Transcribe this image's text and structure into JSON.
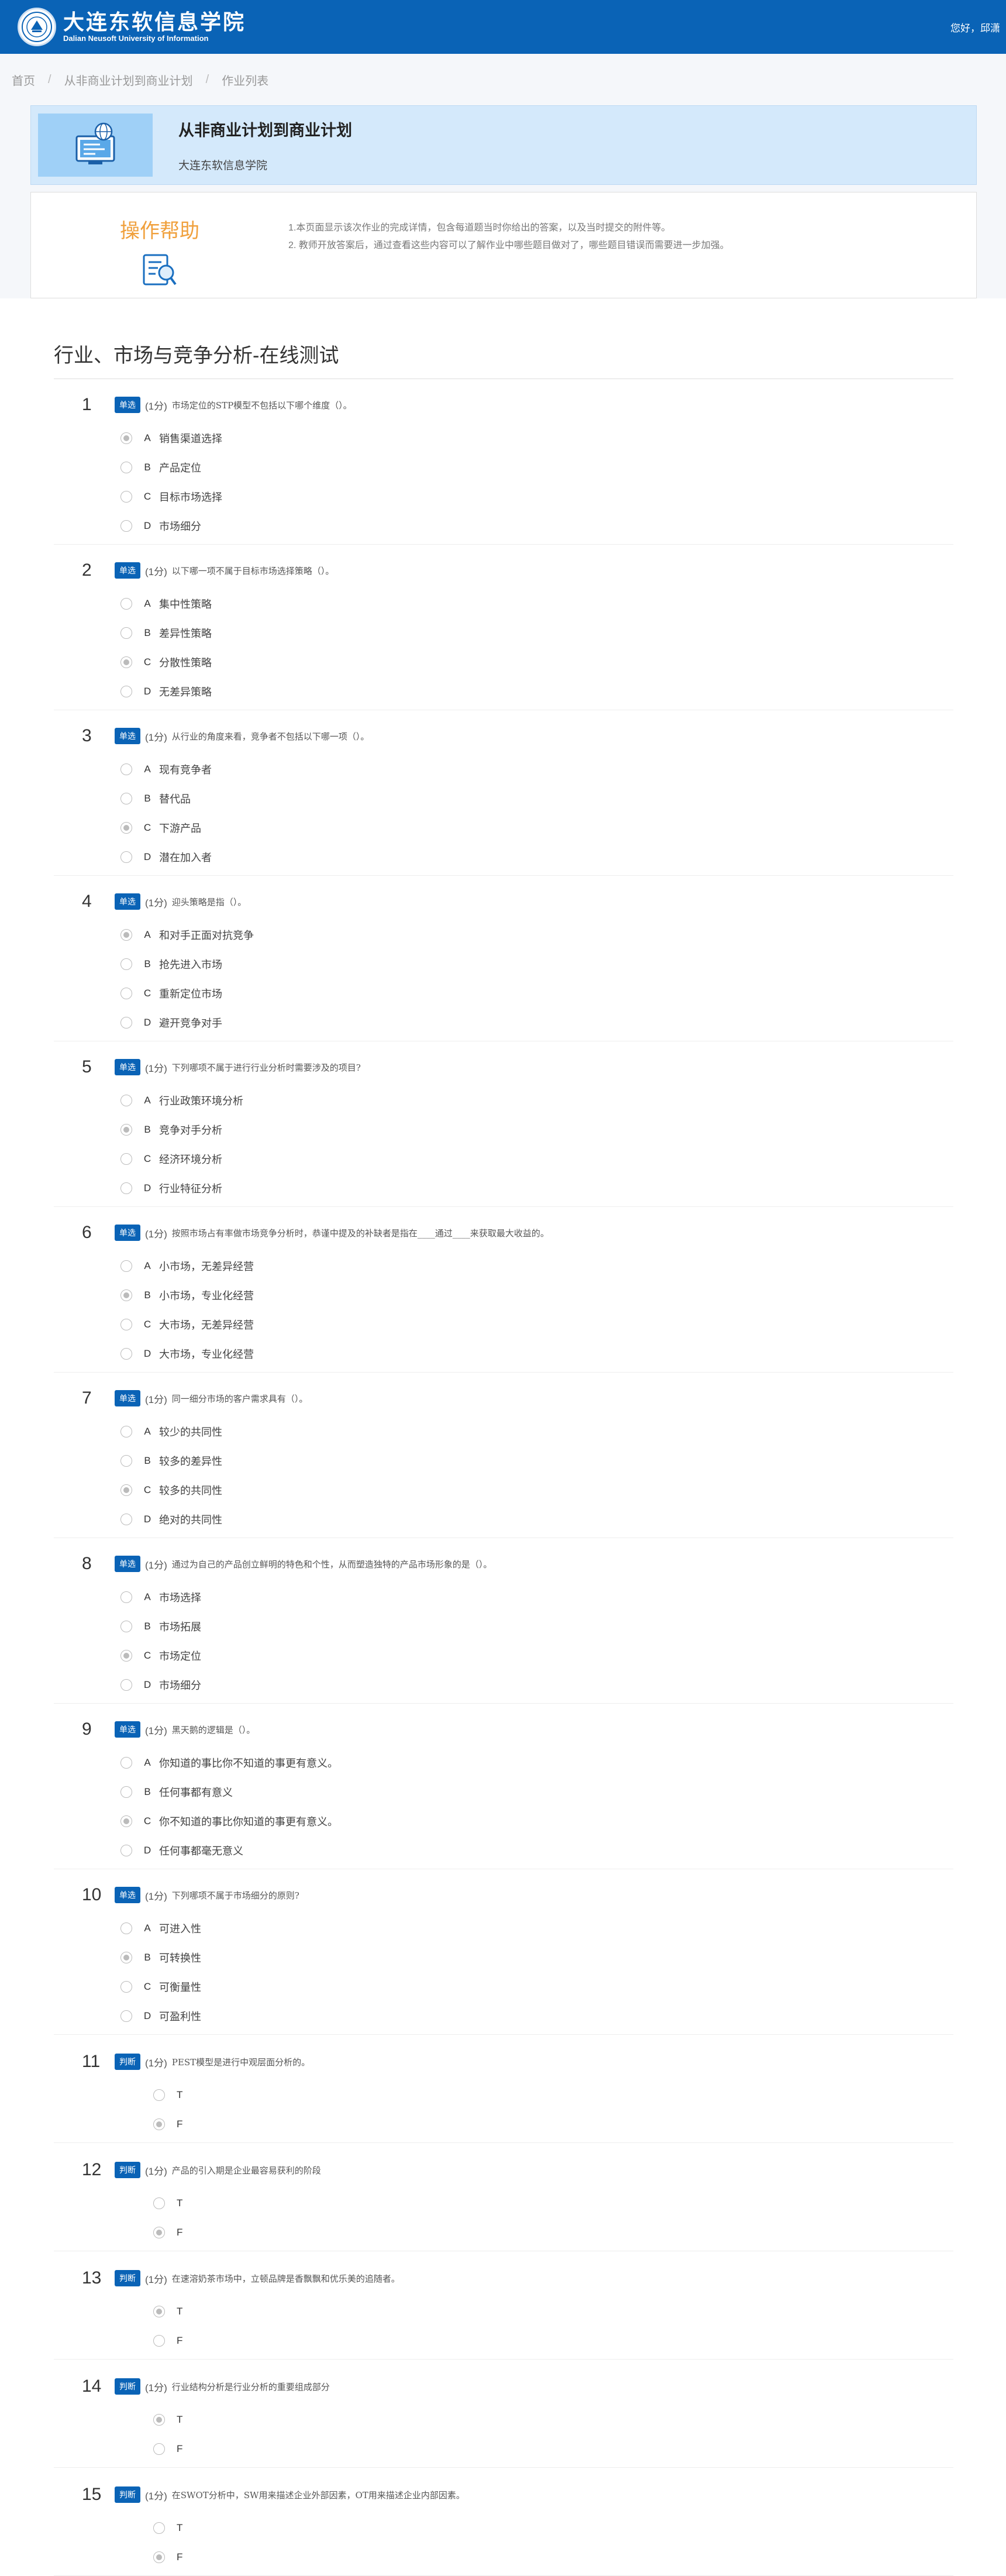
{
  "header": {
    "logo_cn": "大连东软信息学院",
    "logo_en": "Dalian Neusoft University of Information",
    "greeting": "您好，邱潇"
  },
  "breadcrumb": [
    "首页",
    "从非商业计划到商业计划",
    "作业列表"
  ],
  "course": {
    "title": "从非商业计划到商业计划",
    "school": "大连东软信息学院"
  },
  "help": {
    "title": "操作帮助",
    "lines": [
      "1.本页面显示该次作业的完成详情，包含每道题当时你给出的答案，以及当时提交的附件等。",
      "2. 教师开放答案后，通过查看这些内容可以了解作业中哪些题目做对了，哪些题目错误而需要进一步加强。"
    ]
  },
  "section_title": "行业、市场与竞争分析-在线测试",
  "questions": [
    {
      "num": "1",
      "type": "单选",
      "score": "(1分)",
      "text": "市场定位的STP模型不包括以下哪个维度（）。",
      "options": [
        {
          "l": "A",
          "t": "销售渠道选择",
          "c": true
        },
        {
          "l": "B",
          "t": "产品定位",
          "c": false
        },
        {
          "l": "C",
          "t": "目标市场选择",
          "c": false
        },
        {
          "l": "D",
          "t": "市场细分",
          "c": false
        }
      ]
    },
    {
      "num": "2",
      "type": "单选",
      "score": "(1分)",
      "text": "以下哪一项不属于目标市场选择策略（）。",
      "options": [
        {
          "l": "A",
          "t": "集中性策略",
          "c": false
        },
        {
          "l": "B",
          "t": "差异性策略",
          "c": false
        },
        {
          "l": "C",
          "t": "分散性策略",
          "c": true
        },
        {
          "l": "D",
          "t": "无差异策略",
          "c": false
        }
      ]
    },
    {
      "num": "3",
      "type": "单选",
      "score": "(1分)",
      "text": "从行业的角度来看，竞争者不包括以下哪一项（）。",
      "options": [
        {
          "l": "A",
          "t": "现有竞争者",
          "c": false
        },
        {
          "l": "B",
          "t": "替代品",
          "c": false
        },
        {
          "l": "C",
          "t": "下游产品",
          "c": true
        },
        {
          "l": "D",
          "t": "潜在加入者",
          "c": false
        }
      ]
    },
    {
      "num": "4",
      "type": "单选",
      "score": "(1分)",
      "text": "迎头策略是指（）。",
      "options": [
        {
          "l": "A",
          "t": "和对手正面对抗竞争",
          "c": true
        },
        {
          "l": "B",
          "t": "抢先进入市场",
          "c": false
        },
        {
          "l": "C",
          "t": "重新定位市场",
          "c": false
        },
        {
          "l": "D",
          "t": "避开竞争对手",
          "c": false
        }
      ]
    },
    {
      "num": "5",
      "type": "单选",
      "score": "(1分)",
      "text": "下列哪项不属于进行行业分析时需要涉及的项目?",
      "options": [
        {
          "l": "A",
          "t": "行业政策环境分析",
          "c": false
        },
        {
          "l": "B",
          "t": "竞争对手分析",
          "c": true
        },
        {
          "l": "C",
          "t": "经济环境分析",
          "c": false
        },
        {
          "l": "D",
          "t": "行业特征分析",
          "c": false
        }
      ]
    },
    {
      "num": "6",
      "type": "单选",
      "score": "(1分)",
      "text": "按照市场占有率做市场竞争分析时，恭谨中提及的补缺者是指在____通过____来获取最大收益的。",
      "options": [
        {
          "l": "A",
          "t": "小市场，无差异经营",
          "c": false
        },
        {
          "l": "B",
          "t": "小市场，专业化经营",
          "c": true
        },
        {
          "l": "C",
          "t": "大市场，无差异经营",
          "c": false
        },
        {
          "l": "D",
          "t": "大市场，专业化经营",
          "c": false
        }
      ]
    },
    {
      "num": "7",
      "type": "单选",
      "score": "(1分)",
      "text": "同一细分市场的客户需求具有（）。",
      "options": [
        {
          "l": "A",
          "t": "较少的共同性",
          "c": false
        },
        {
          "l": "B",
          "t": "较多的差异性",
          "c": false
        },
        {
          "l": "C",
          "t": "较多的共同性",
          "c": true
        },
        {
          "l": "D",
          "t": "绝对的共同性",
          "c": false
        }
      ]
    },
    {
      "num": "8",
      "type": "单选",
      "score": "(1分)",
      "text": "通过为自己的产品创立鲜明的特色和个性，从而塑造独特的产品市场形象的是（）。",
      "options": [
        {
          "l": "A",
          "t": "市场选择",
          "c": false
        },
        {
          "l": "B",
          "t": "市场拓展",
          "c": false
        },
        {
          "l": "C",
          "t": "市场定位",
          "c": true
        },
        {
          "l": "D",
          "t": "市场细分",
          "c": false
        }
      ]
    },
    {
      "num": "9",
      "type": "单选",
      "score": "(1分)",
      "text": "黑天鹅的逻辑是（）。",
      "options": [
        {
          "l": "A",
          "t": "你知道的事比你不知道的事更有意义。",
          "c": false
        },
        {
          "l": "B",
          "t": "任何事都有意义",
          "c": false
        },
        {
          "l": "C",
          "t": "你不知道的事比你知道的事更有意义。",
          "c": true
        },
        {
          "l": "D",
          "t": "任何事都毫无意义",
          "c": false
        }
      ]
    },
    {
      "num": "10",
      "type": "单选",
      "score": "(1分)",
      "text": "下列哪项不属于市场细分的原则?",
      "options": [
        {
          "l": "A",
          "t": "可进入性",
          "c": false
        },
        {
          "l": "B",
          "t": "可转换性",
          "c": true
        },
        {
          "l": "C",
          "t": "可衡量性",
          "c": false
        },
        {
          "l": "D",
          "t": "可盈利性",
          "c": false
        }
      ]
    },
    {
      "num": "11",
      "type": "判断",
      "score": "(1分)",
      "text": "PEST模型是进行中观层面分析的。",
      "options": [
        {
          "l": "T",
          "t": "",
          "c": false
        },
        {
          "l": "F",
          "t": "",
          "c": true
        }
      ]
    },
    {
      "num": "12",
      "type": "判断",
      "score": "(1分)",
      "text": "产品的引入期是企业最容易获利的阶段",
      "options": [
        {
          "l": "T",
          "t": "",
          "c": false
        },
        {
          "l": "F",
          "t": "",
          "c": true
        }
      ]
    },
    {
      "num": "13",
      "type": "判断",
      "score": "(1分)",
      "text": "在速溶奶茶市场中，立顿品牌是香飘飘和优乐美的追随者。",
      "options": [
        {
          "l": "T",
          "t": "",
          "c": true
        },
        {
          "l": "F",
          "t": "",
          "c": false
        }
      ]
    },
    {
      "num": "14",
      "type": "判断",
      "score": "(1分)",
      "text": "行业结构分析是行业分析的重要组成部分",
      "options": [
        {
          "l": "T",
          "t": "",
          "c": true
        },
        {
          "l": "F",
          "t": "",
          "c": false
        }
      ]
    },
    {
      "num": "15",
      "type": "判断",
      "score": "(1分)",
      "text": "在SWOT分析中，SW用来描述企业外部因素，OT用来描述企业内部因素。",
      "options": [
        {
          "l": "T",
          "t": "",
          "c": false
        },
        {
          "l": "F",
          "t": "",
          "c": true
        }
      ]
    }
  ]
}
